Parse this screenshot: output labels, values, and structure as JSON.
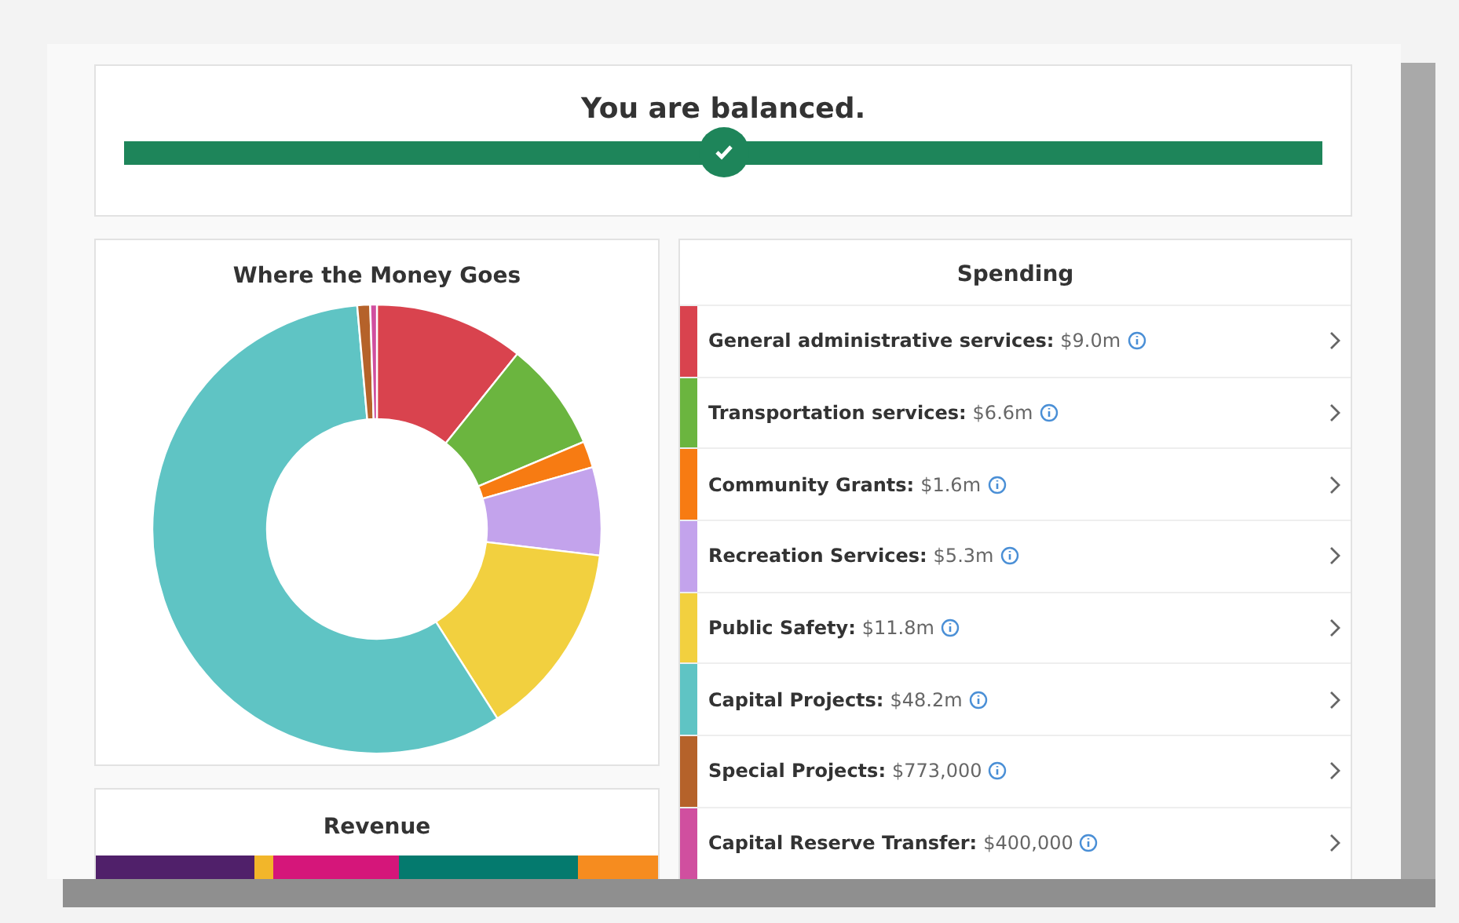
{
  "balance": {
    "title": "You are balanced.",
    "level": 0.5
  },
  "money_chart": {
    "title": "Where the Money Goes"
  },
  "spending": {
    "title": "Spending",
    "items": [
      {
        "label": "General administrative services:",
        "amount": "$9.0m",
        "color": "#d9434e"
      },
      {
        "label": "Transportation services:",
        "amount": "$6.6m",
        "color": "#6bb53f"
      },
      {
        "label": "Community Grants:",
        "amount": "$1.6m",
        "color": "#f77b12"
      },
      {
        "label": "Recreation Services:",
        "amount": "$5.3m",
        "color": "#c3a3ec"
      },
      {
        "label": "Public Safety:",
        "amount": "$11.8m",
        "color": "#f2d03f"
      },
      {
        "label": "Capital Projects:",
        "amount": "$48.2m",
        "color": "#5fc4c4"
      },
      {
        "label": "Special Projects:",
        "amount": "$773,000",
        "color": "#b5622a"
      },
      {
        "label": "Capital Reserve Transfer:",
        "amount": "$400,000",
        "color": "#d04f9f"
      }
    ]
  },
  "revenue": {
    "title": "Revenue",
    "segments": [
      {
        "color": "#50206a"
      },
      {
        "color": "#f2b62a"
      },
      {
        "color": "#d5167a"
      },
      {
        "color": "#047a6e"
      },
      {
        "color": "#f68c1f"
      }
    ]
  }
}
